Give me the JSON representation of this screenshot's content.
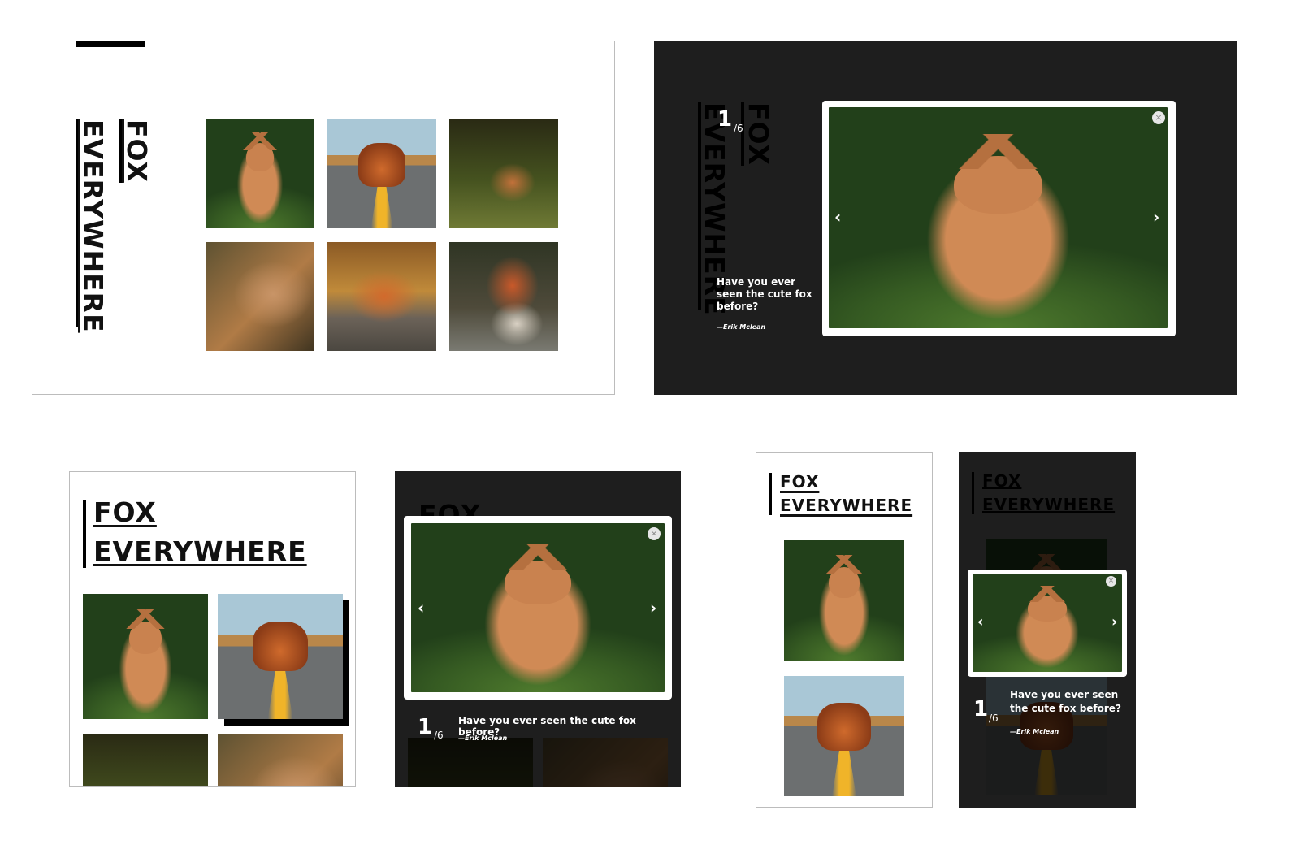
{
  "brand": {
    "title_line1": "FOX",
    "title_line2": "EVERYWHERE"
  },
  "lightbox": {
    "current": "1",
    "total": "/6",
    "quote": "Have you ever seen the cute fox before?",
    "quote_desktop_line1": "Have you ever",
    "quote_desktop_line2": "seen the cute fox",
    "quote_desktop_line3": "before?",
    "quote_mobile_line1": "Have you ever seen",
    "quote_mobile_line2": "the cute fox before?",
    "author": "—Erik Mclean",
    "close_glyph": "×",
    "prev_glyph": "‹",
    "next_glyph": "›"
  },
  "gallery": {
    "photos": [
      "fox-in-grass",
      "fox-on-road",
      "fox-in-tall-grass",
      "fox-lying-down",
      "fox-on-path",
      "fox-on-rocks"
    ]
  },
  "colors": {
    "dark_bg": "#1e1e1e",
    "text": "#000000",
    "accent_road": "#f0b429"
  }
}
